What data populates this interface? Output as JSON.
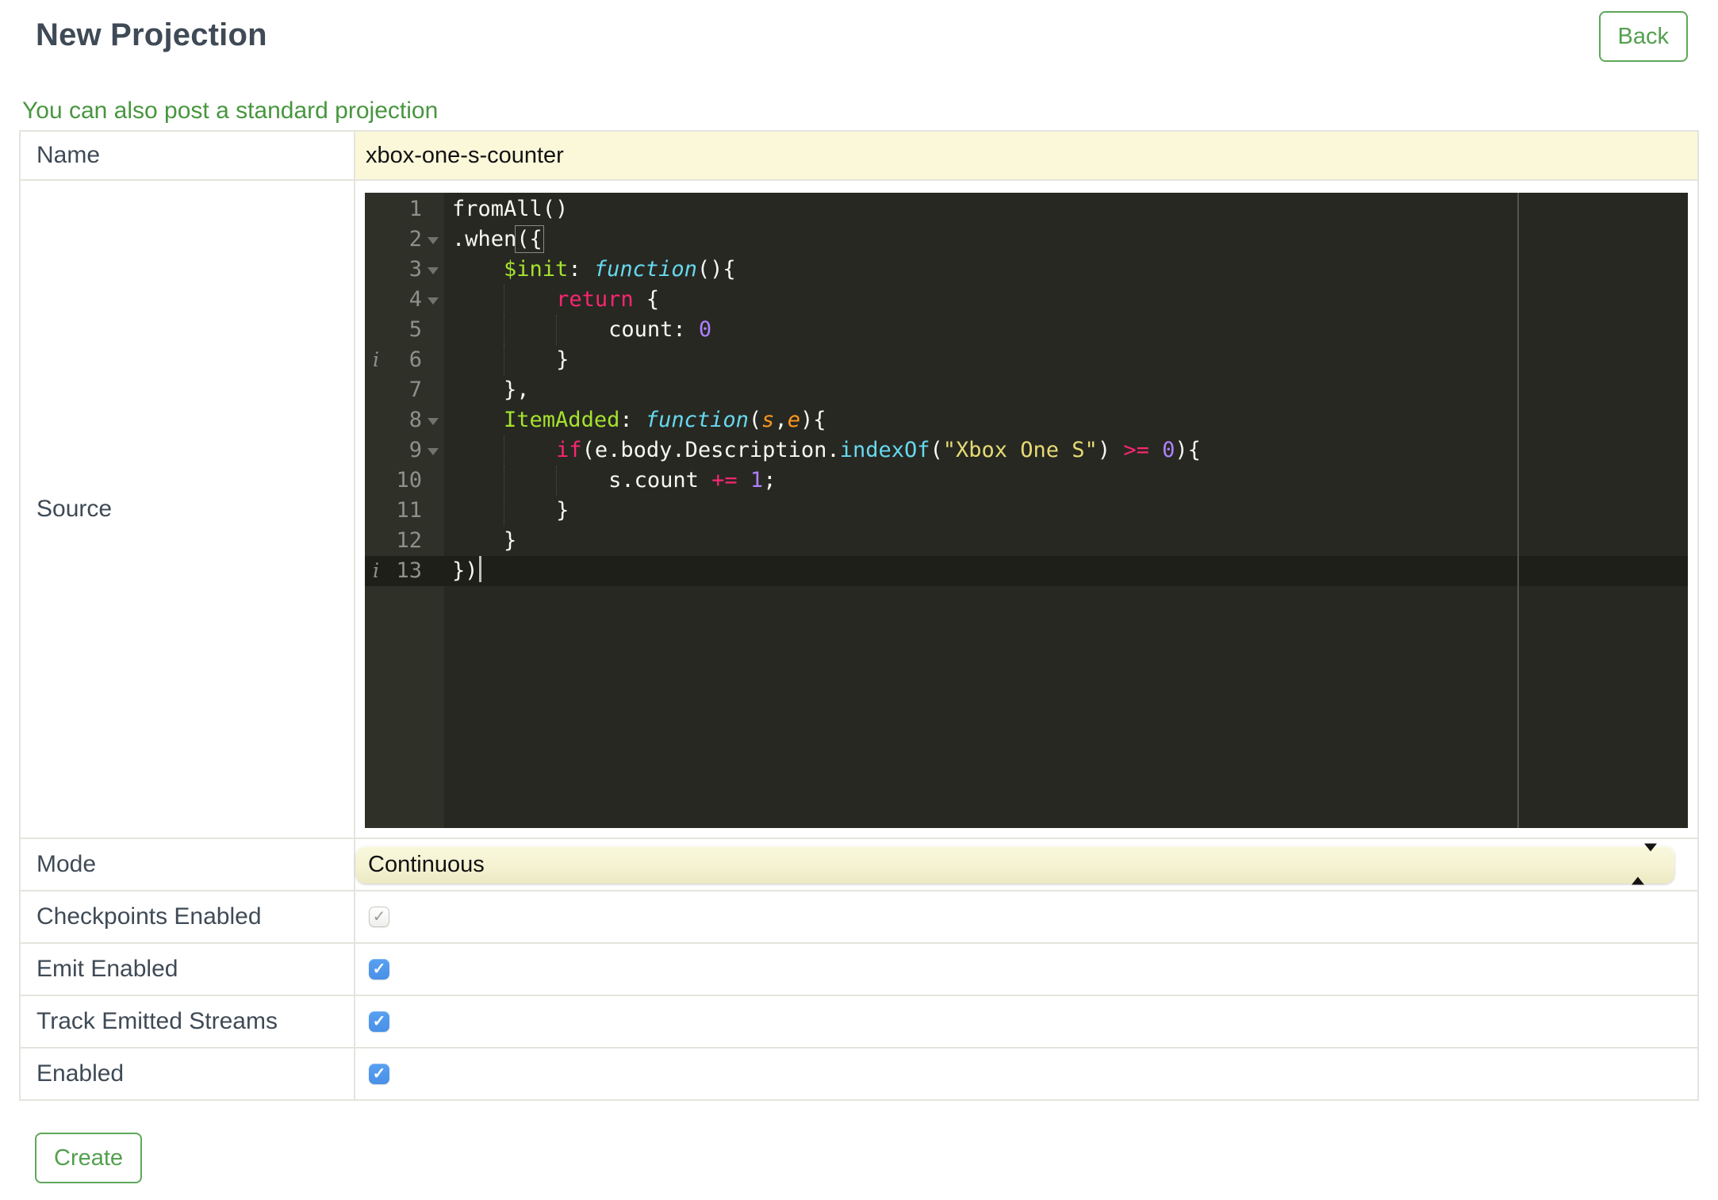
{
  "colors": {
    "accent_green": "#57a453",
    "link_green": "#48963f",
    "heading_slate": "#3f4a56",
    "field_yellow": "#fbf8da",
    "checkbox_blue": "#4a90e8",
    "table_border": "#e4e4de",
    "editor_background": "#272822",
    "editor_gutter": "#2f3129",
    "editor_gutter_text": "#8f908a",
    "editor_active_line": "#1e1f19",
    "token_keyword": "#f92672",
    "token_storage": "#66d9ef",
    "token_function_name": "#a6e22e",
    "token_parameter": "#fd971f",
    "token_string": "#e6db74",
    "token_number": "#ae81ff",
    "token_plain": "#f8f8f2"
  },
  "icons": {
    "checkmark": "✓",
    "info": "i"
  },
  "header": {
    "title": "New Projection",
    "back_label": "Back"
  },
  "link_text": "You can also post a standard projection",
  "form": {
    "name_label": "Name",
    "name_value": "xbox-one-s-counter",
    "source_label": "Source",
    "mode_label": "Mode",
    "mode_value": "Continuous",
    "create_label": "Create",
    "boolean_rows": [
      {
        "label": "Checkpoints Enabled",
        "checked": true,
        "disabled": true
      },
      {
        "label": "Emit Enabled",
        "checked": true,
        "disabled": false
      },
      {
        "label": "Track Emitted Streams",
        "checked": true,
        "disabled": false
      },
      {
        "label": "Enabled",
        "checked": true,
        "disabled": false
      }
    ]
  },
  "editor": {
    "active_line": 13,
    "lines": [
      {
        "n": 1,
        "tokens": [
          {
            "t": "fromAll()",
            "y": "plain"
          }
        ]
      },
      {
        "n": 2,
        "fold": true,
        "tokens": [
          {
            "t": ".when",
            "y": "plain"
          },
          {
            "t": "({",
            "y": "bracket"
          }
        ]
      },
      {
        "n": 3,
        "fold": true,
        "tokens": [
          {
            "t": "    ",
            "y": "indent"
          },
          {
            "t": "$init",
            "y": "fname"
          },
          {
            "t": ": ",
            "y": "plain"
          },
          {
            "t": "function",
            "y": "storage"
          },
          {
            "t": "(){",
            "y": "plain"
          }
        ]
      },
      {
        "n": 4,
        "fold": true,
        "tokens": [
          {
            "t": "    ",
            "y": "indent"
          },
          {
            "t": "    ",
            "y": "indentg"
          },
          {
            "t": "return",
            "y": "keyword"
          },
          {
            "t": " {",
            "y": "plain"
          }
        ]
      },
      {
        "n": 5,
        "tokens": [
          {
            "t": "    ",
            "y": "indent"
          },
          {
            "t": "    ",
            "y": "indentg"
          },
          {
            "t": "    ",
            "y": "indentg"
          },
          {
            "t": "count: ",
            "y": "plain"
          },
          {
            "t": "0",
            "y": "number"
          }
        ]
      },
      {
        "n": 6,
        "info": true,
        "tokens": [
          {
            "t": "    ",
            "y": "indent"
          },
          {
            "t": "    ",
            "y": "indentg"
          },
          {
            "t": "}",
            "y": "plain"
          }
        ]
      },
      {
        "n": 7,
        "tokens": [
          {
            "t": "    ",
            "y": "indent"
          },
          {
            "t": "},",
            "y": "plain"
          }
        ]
      },
      {
        "n": 8,
        "fold": true,
        "tokens": [
          {
            "t": "    ",
            "y": "indent"
          },
          {
            "t": "ItemAdded",
            "y": "fname"
          },
          {
            "t": ": ",
            "y": "plain"
          },
          {
            "t": "function",
            "y": "storage"
          },
          {
            "t": "(",
            "y": "plain"
          },
          {
            "t": "s",
            "y": "param"
          },
          {
            "t": ",",
            "y": "plain"
          },
          {
            "t": "e",
            "y": "param"
          },
          {
            "t": "){",
            "y": "plain"
          }
        ]
      },
      {
        "n": 9,
        "fold": true,
        "tokens": [
          {
            "t": "    ",
            "y": "indent"
          },
          {
            "t": "    ",
            "y": "indentg"
          },
          {
            "t": "if",
            "y": "keyword"
          },
          {
            "t": "(e.body.Description.",
            "y": "plain"
          },
          {
            "t": "indexOf",
            "y": "support"
          },
          {
            "t": "(",
            "y": "plain"
          },
          {
            "t": "\"Xbox One S\"",
            "y": "string"
          },
          {
            "t": ") ",
            "y": "plain"
          },
          {
            "t": ">=",
            "y": "keyword"
          },
          {
            "t": " ",
            "y": "plain"
          },
          {
            "t": "0",
            "y": "number"
          },
          {
            "t": "){",
            "y": "plain"
          }
        ]
      },
      {
        "n": 10,
        "tokens": [
          {
            "t": "    ",
            "y": "indent"
          },
          {
            "t": "    ",
            "y": "indentg"
          },
          {
            "t": "    ",
            "y": "indentg"
          },
          {
            "t": "s.count ",
            "y": "plain"
          },
          {
            "t": "+=",
            "y": "keyword"
          },
          {
            "t": " ",
            "y": "plain"
          },
          {
            "t": "1",
            "y": "number"
          },
          {
            "t": ";",
            "y": "plain"
          }
        ]
      },
      {
        "n": 11,
        "tokens": [
          {
            "t": "    ",
            "y": "indent"
          },
          {
            "t": "    ",
            "y": "indentg"
          },
          {
            "t": "}",
            "y": "plain"
          }
        ]
      },
      {
        "n": 12,
        "tokens": [
          {
            "t": "    ",
            "y": "indent"
          },
          {
            "t": "}",
            "y": "plain"
          }
        ]
      },
      {
        "n": 13,
        "info": true,
        "cursor": true,
        "tokens": [
          {
            "t": "})",
            "y": "plain"
          }
        ]
      }
    ]
  }
}
